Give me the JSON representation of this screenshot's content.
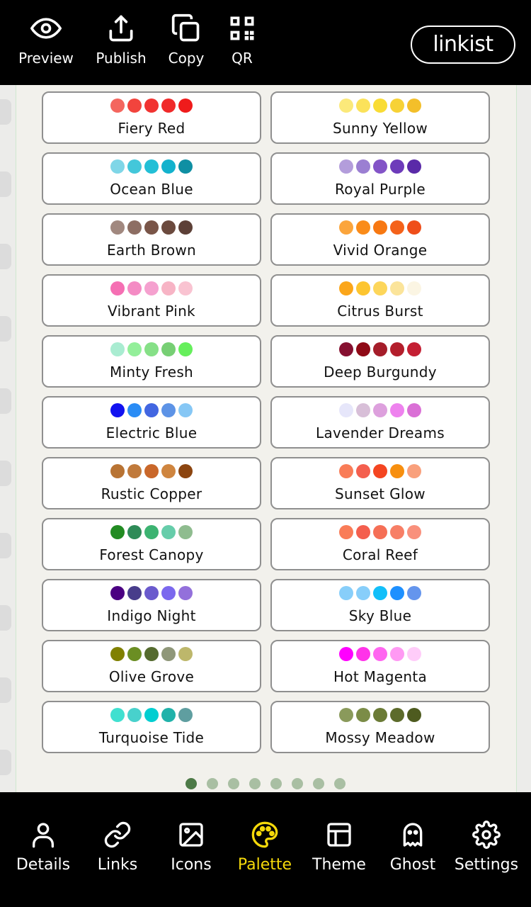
{
  "toolbar": {
    "items": [
      {
        "label": "Preview",
        "icon": "eye-icon"
      },
      {
        "label": "Publish",
        "icon": "upload-icon"
      },
      {
        "label": "Copy",
        "icon": "copy-icon"
      },
      {
        "label": "QR",
        "icon": "qr-code-icon"
      }
    ],
    "logo": "linkist"
  },
  "palettes": [
    {
      "name": "Fiery Red",
      "colors": [
        "#f4665e",
        "#f2443d",
        "#f13331",
        "#f02a2a",
        "#ef1b1b"
      ]
    },
    {
      "name": "Sunny Yellow",
      "colors": [
        "#fbe97a",
        "#fbe25a",
        "#f9dc35",
        "#f7d236",
        "#f3bf2a"
      ]
    },
    {
      "name": "Ocean Blue",
      "colors": [
        "#7fd6e7",
        "#43c7da",
        "#22bfd6",
        "#13b2cd",
        "#0f8fa3"
      ]
    },
    {
      "name": "Royal Purple",
      "colors": [
        "#b39ddb",
        "#9b7fd2",
        "#8354c7",
        "#6d3bba",
        "#5a2aa8"
      ]
    },
    {
      "name": "Earth Brown",
      "colors": [
        "#a1887f",
        "#8d6e63",
        "#795548",
        "#6b4a3e",
        "#5d4037"
      ]
    },
    {
      "name": "Vivid Orange",
      "colors": [
        "#fba53c",
        "#fa8c1a",
        "#f77812",
        "#f4621a",
        "#ef4e1a"
      ]
    },
    {
      "name": "Vibrant Pink",
      "colors": [
        "#f56fb3",
        "#f48bc4",
        "#f5a1cf",
        "#f7b4c5",
        "#f9c3d1"
      ]
    },
    {
      "name": "Citrus Burst",
      "colors": [
        "#fba61a",
        "#fdc530",
        "#fdd65a",
        "#fbe49a",
        "#fbf5e3"
      ]
    },
    {
      "name": "Minty Fresh",
      "colors": [
        "#a9ecd1",
        "#93ef9a",
        "#86e087",
        "#77cf74",
        "#66ef5c"
      ]
    },
    {
      "name": "Deep Burgundy",
      "colors": [
        "#861030",
        "#8f0a16",
        "#a51d2a",
        "#b31e2b",
        "#c41f33"
      ]
    },
    {
      "name": "Electric Blue",
      "colors": [
        "#1212f0",
        "#2a8cf5",
        "#4266e1",
        "#5d93e6",
        "#86c7f5"
      ]
    },
    {
      "name": "Lavender Dreams",
      "colors": [
        "#e6e6fa",
        "#d8bfd8",
        "#dda0dd",
        "#ee82ee",
        "#da70d6"
      ]
    },
    {
      "name": "Rustic Copper",
      "colors": [
        "#b87333",
        "#c07a3b",
        "#c9672a",
        "#cf853f",
        "#8c4510"
      ]
    },
    {
      "name": "Sunset Glow",
      "colors": [
        "#f97c57",
        "#f45f4e",
        "#f44521",
        "#f78f0f",
        "#f9a07c"
      ]
    },
    {
      "name": "Forest Canopy",
      "colors": [
        "#228b22",
        "#2e8b57",
        "#3cb371",
        "#66cdaa",
        "#8fbc8f"
      ]
    },
    {
      "name": "Coral Reef",
      "colors": [
        "#f97c57",
        "#f45f4e",
        "#f56f56",
        "#f77f66",
        "#f9907c"
      ]
    },
    {
      "name": "Indigo Night",
      "colors": [
        "#4b0082",
        "#483d8b",
        "#6a5acd",
        "#7b68ee",
        "#9370db"
      ]
    },
    {
      "name": "Sky Blue",
      "colors": [
        "#87cefa",
        "#87cefa",
        "#12bff9",
        "#1e90ff",
        "#6495ed"
      ]
    },
    {
      "name": "Olive Grove",
      "colors": [
        "#808000",
        "#6b8e23",
        "#556b2f",
        "#8f9779",
        "#bdb76b"
      ]
    },
    {
      "name": "Hot Magenta",
      "colors": [
        "#ff00ff",
        "#ff33e9",
        "#ff66f0",
        "#ff99f3",
        "#ffccf9"
      ]
    },
    {
      "name": "Turquoise Tide",
      "colors": [
        "#40e0d0",
        "#48d1cc",
        "#00ced1",
        "#20b2aa",
        "#5f9ea0"
      ]
    },
    {
      "name": "Mossy Meadow",
      "colors": [
        "#8a9a5b",
        "#7b8c47",
        "#6b7b36",
        "#5d6b2b",
        "#4e5b1f"
      ]
    }
  ],
  "pager": {
    "count": 8,
    "active": 0
  },
  "nav": {
    "items": [
      {
        "label": "Details",
        "icon": "user-icon"
      },
      {
        "label": "Links",
        "icon": "link-icon"
      },
      {
        "label": "Icons",
        "icon": "image-icon"
      },
      {
        "label": "Palette",
        "icon": "palette-icon"
      },
      {
        "label": "Theme",
        "icon": "layout-icon"
      },
      {
        "label": "Ghost",
        "icon": "ghost-icon"
      },
      {
        "label": "Settings",
        "icon": "gear-icon"
      }
    ],
    "active_label": "Palette",
    "active_color": "#f5d90a"
  }
}
